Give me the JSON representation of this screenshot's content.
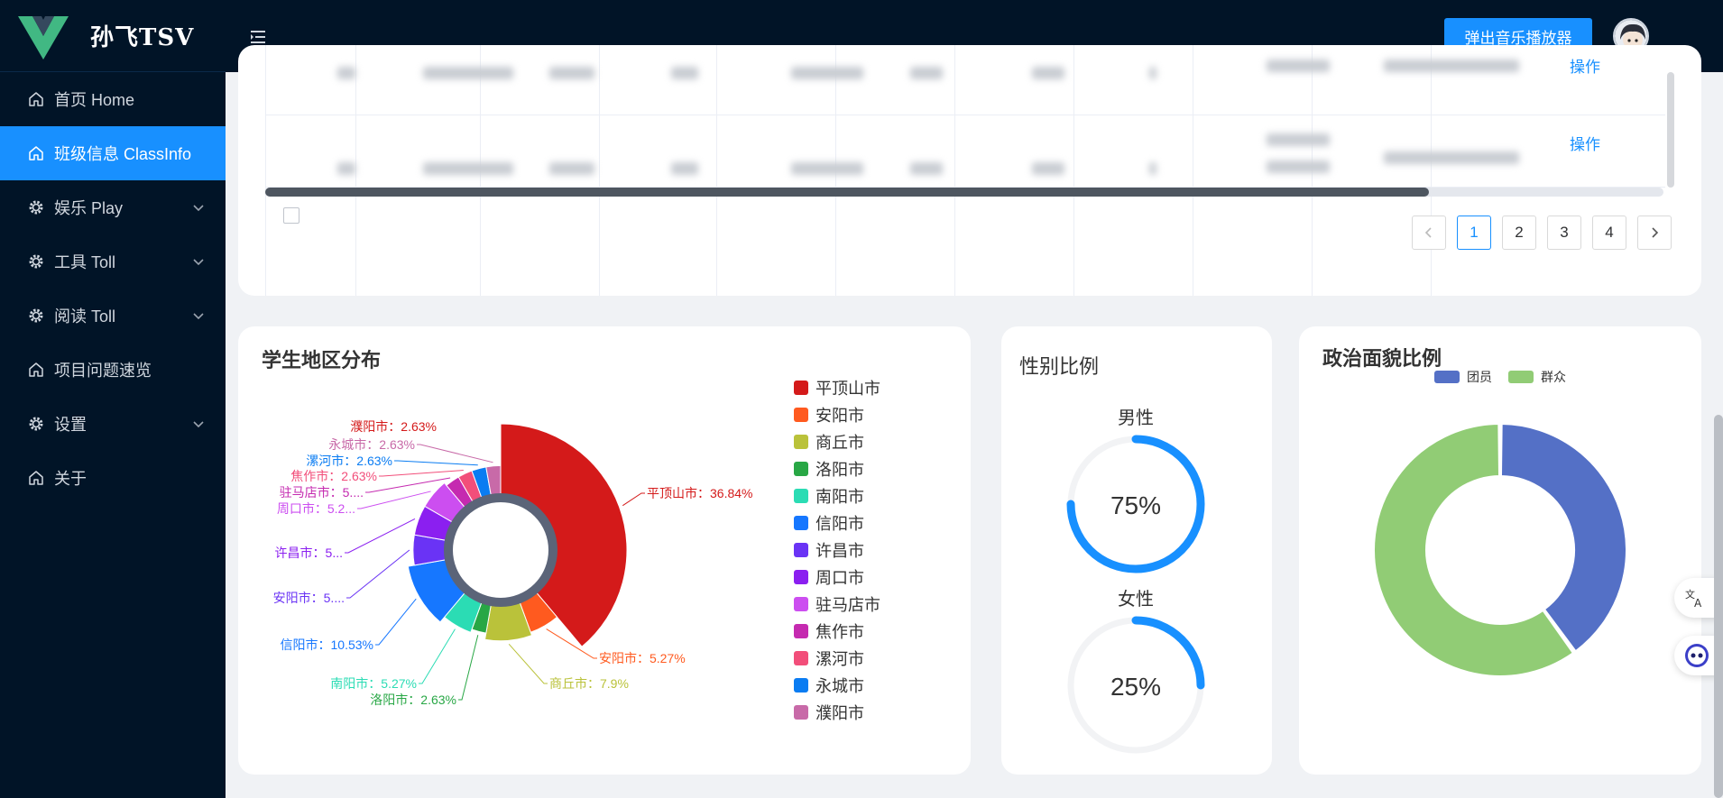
{
  "app": {
    "title": "孙飞TSV"
  },
  "sidebar": {
    "items": [
      {
        "label": "首页 Home",
        "icon": "home-icon",
        "expandable": false,
        "active": false
      },
      {
        "label": "班级信息 ClassInfo",
        "icon": "home-icon",
        "expandable": false,
        "active": true
      },
      {
        "label": "娱乐 Play",
        "icon": "gear-icon",
        "expandable": true,
        "active": false
      },
      {
        "label": "工具 Toll",
        "icon": "gear-icon",
        "expandable": true,
        "active": false
      },
      {
        "label": "阅读 Toll",
        "icon": "gear-icon",
        "expandable": true,
        "active": false
      },
      {
        "label": "项目问题速览",
        "icon": "home-icon",
        "expandable": false,
        "active": false
      },
      {
        "label": "设置",
        "icon": "gear-icon",
        "expandable": true,
        "active": false
      },
      {
        "label": "关于",
        "icon": "home-icon",
        "expandable": false,
        "active": false
      }
    ]
  },
  "header": {
    "music_button": "弹出音乐播放器"
  },
  "table": {
    "operation_label": "操作",
    "pagination": {
      "pages": [
        "1",
        "2",
        "3",
        "4"
      ],
      "current": "1"
    }
  },
  "region_card": {
    "title": "学生地区分布"
  },
  "gender_card": {
    "title": "性别比例",
    "male_label": "男性",
    "male_value": "75%",
    "male_fraction": 0.75,
    "female_label": "女性",
    "female_value": "25%",
    "female_fraction": 0.25
  },
  "politics_card": {
    "title": "政治面貌比例"
  },
  "colors": {
    "accent": "#1890ff",
    "sidebar_bg": "#011427"
  },
  "chart_data": [
    {
      "type": "pie",
      "title": "学生地区分布",
      "slices": [
        {
          "name": "平顶山市",
          "value": 36.84,
          "label": "平顶山市：36.84%",
          "color": "#d41a1a"
        },
        {
          "name": "安阳市",
          "value": 5.27,
          "label": "安阳市：5.27%",
          "color": "#ff5a1f"
        },
        {
          "name": "商丘市",
          "value": 7.9,
          "label": "商丘市：7.9%",
          "color": "#bac23a"
        },
        {
          "name": "洛阳市",
          "value": 2.63,
          "label": "洛阳市：2.63%",
          "color": "#28a745"
        },
        {
          "name": "南阳市",
          "value": 5.27,
          "label": "南阳市：5.27%",
          "color": "#2bdcb4"
        },
        {
          "name": "信阳市",
          "value": 10.53,
          "label": "信阳市：10.53%",
          "color": "#1677ff"
        },
        {
          "name": "许昌市",
          "value": 5.27,
          "label": "安阳市：5....",
          "color": "#6a33f5"
        },
        {
          "name": "周口市",
          "value": 5.27,
          "label": "许昌市：5...",
          "color": "#8b1ff0"
        },
        {
          "name": "驻马店市",
          "value": 5.27,
          "label": "周口市：5.2...",
          "color": "#cc4ef0"
        },
        {
          "name": "焦作市",
          "value": 2.63,
          "label": "驻马店市：5....",
          "color": "#c52ab0"
        },
        {
          "name": "漯河市",
          "value": 2.63,
          "label": "焦作市：2.63%",
          "color": "#f24e7a"
        },
        {
          "name": "永城市",
          "value": 2.63,
          "label": "漯河市：2.63%",
          "color": "#0a7cf2"
        },
        {
          "name": "濮阳市",
          "value": 2.63,
          "label": "永城市：2.63%",
          "color": "#c86aa8"
        }
      ],
      "extra_label": "濮阳市：2.63%",
      "legend": [
        "平顶山市",
        "安阳市",
        "商丘市",
        "洛阳市",
        "南阳市",
        "信阳市",
        "许昌市",
        "周口市",
        "驻马店市",
        "焦作市",
        "漯河市",
        "永城市",
        "濮阳市"
      ],
      "legend_position": "right"
    },
    {
      "type": "pie",
      "title": "政治面貌比例",
      "slices": [
        {
          "name": "团员",
          "value": 40,
          "color": "#5470c6"
        },
        {
          "name": "群众",
          "value": 60,
          "color": "#91cc75"
        }
      ],
      "legend": [
        "团员",
        "群众"
      ],
      "legend_position": "top"
    }
  ]
}
